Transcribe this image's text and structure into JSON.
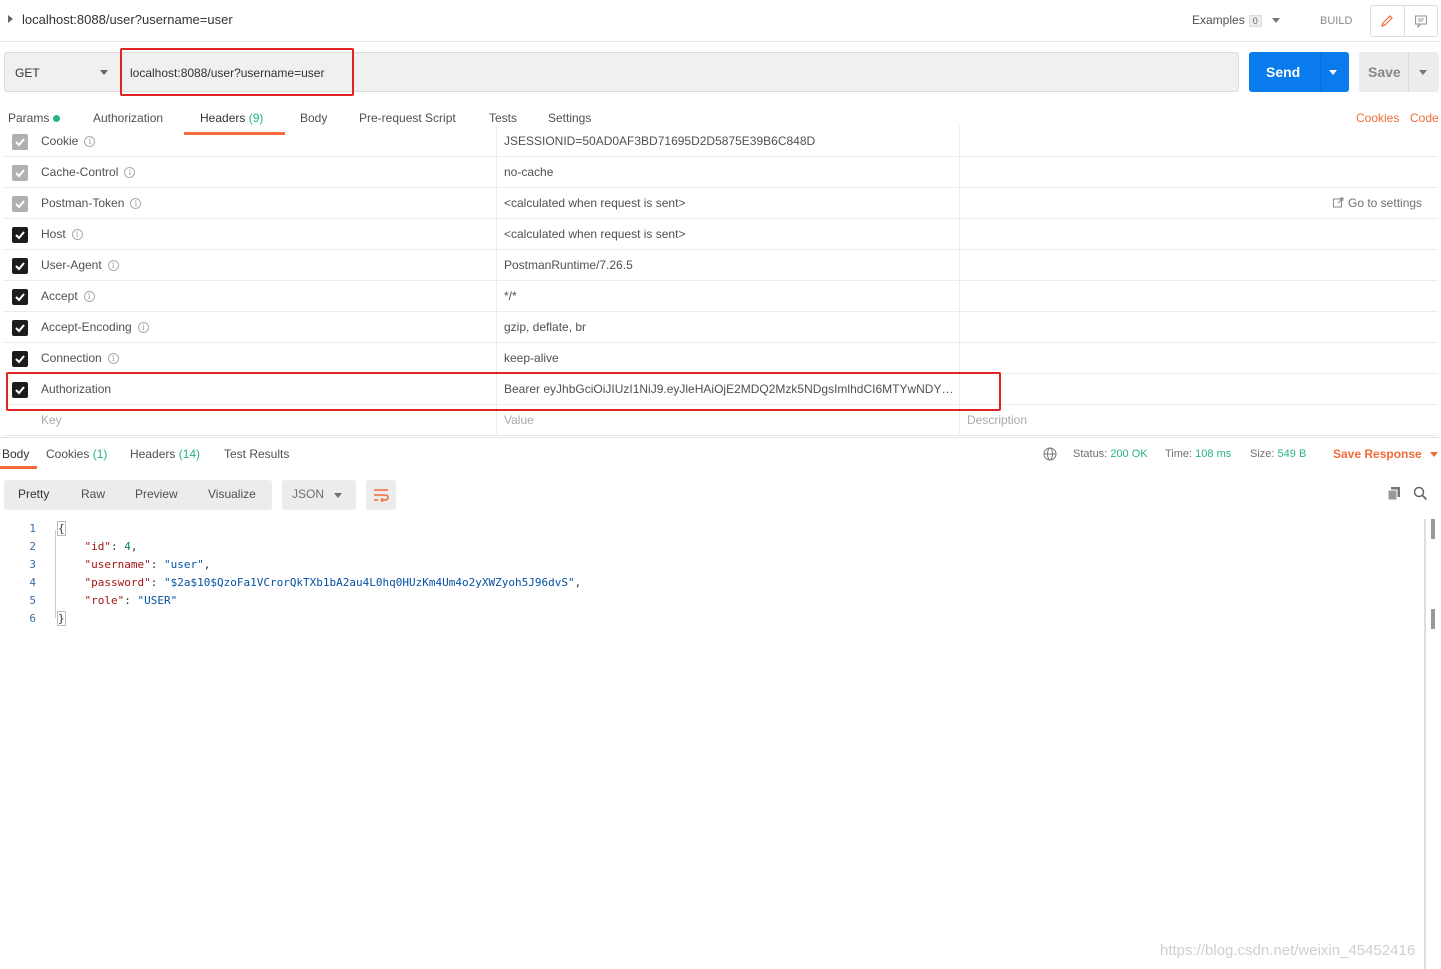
{
  "header": {
    "title": "localhost:8088/user?username=user",
    "examples_label": "Examples",
    "examples_count": "0",
    "build_label": "BUILD"
  },
  "request": {
    "method": "GET",
    "url": "localhost:8088/user?username=user",
    "send_label": "Send",
    "save_label": "Save"
  },
  "request_tabs": [
    {
      "label": "Params",
      "count": ""
    },
    {
      "label": "Authorization",
      "count": ""
    },
    {
      "label": "Headers",
      "count": "(9)"
    },
    {
      "label": "Body",
      "count": ""
    },
    {
      "label": "Pre-request Script",
      "count": ""
    },
    {
      "label": "Tests",
      "count": ""
    },
    {
      "label": "Settings",
      "count": ""
    }
  ],
  "links": {
    "cookies": "Cookies",
    "code": "Code"
  },
  "headers": [
    {
      "key": "Cookie",
      "value": "JSESSIONID=50AD0AF3BD71695D2D5875E39B6C848D",
      "checked": "disabled"
    },
    {
      "key": "Cache-Control",
      "value": "no-cache",
      "checked": "disabled"
    },
    {
      "key": "Postman-Token",
      "value": "<calculated when request is sent>",
      "checked": "disabled"
    },
    {
      "key": "Host",
      "value": "<calculated when request is sent>",
      "checked": "on"
    },
    {
      "key": "User-Agent",
      "value": "PostmanRuntime/7.26.5",
      "checked": "on"
    },
    {
      "key": "Accept",
      "value": "*/*",
      "checked": "on"
    },
    {
      "key": "Accept-Encoding",
      "value": "gzip, deflate, br",
      "checked": "on"
    },
    {
      "key": "Connection",
      "value": "keep-alive",
      "checked": "on"
    },
    {
      "key": "Authorization",
      "value": "Bearer eyJhbGciOiJIUzI1NiJ9.eyJleHAiOjE2MDQ2Mzk5NDgsImlhdCI6MTYwNDY…",
      "checked": "on"
    }
  ],
  "go_to_settings": "Go to settings",
  "placeholders": {
    "key": "Key",
    "value": "Value",
    "description": "Description"
  },
  "response_tabs": [
    {
      "label": "Body",
      "count": ""
    },
    {
      "label": "Cookies",
      "count": "(1)"
    },
    {
      "label": "Headers",
      "count": "(14)"
    },
    {
      "label": "Test Results",
      "count": ""
    }
  ],
  "response_meta": {
    "status_label": "Status:",
    "status": "200 OK",
    "time_label": "Time:",
    "time": "108 ms",
    "size_label": "Size:",
    "size": "549 B",
    "save_response": "Save Response"
  },
  "view_modes": [
    "Pretty",
    "Raw",
    "Preview",
    "Visualize"
  ],
  "format": "JSON",
  "code_lines": [
    "1",
    "2",
    "3",
    "4",
    "5",
    "6"
  ],
  "body_json": {
    "open": "{",
    "id_key": "\"id\"",
    "id_val": "4",
    "username_key": "\"username\"",
    "username_val": "\"user\"",
    "password_key": "\"password\"",
    "password_val": "\"$2a$10$QzoFa1VCrorQkTXb1bA2au4L0hq0HUzKm4Um4o2yXWZyoh5J96dvS\"",
    "role_key": "\"role\"",
    "role_val": "\"USER\"",
    "close": "}"
  },
  "watermark": "https://blog.csdn.net/weixin_45452416",
  "colors": {
    "accent": "#f26b3a",
    "send": "#097bed",
    "success": "#26b47f",
    "highlight": "#e02424"
  }
}
